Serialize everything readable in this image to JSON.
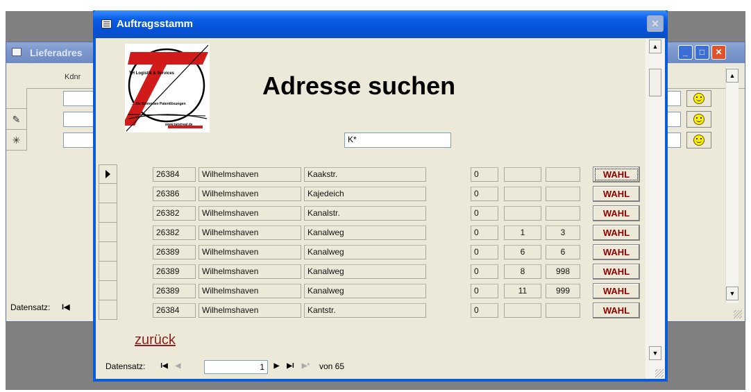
{
  "background_window": {
    "title": "Lieferadres",
    "column_header": "Kdnr",
    "nav_label": "Datensatz:",
    "record_symbols": [
      "",
      "✎",
      "✳"
    ],
    "controls": {
      "minimize": "_",
      "maximize": "□",
      "close": "✕"
    }
  },
  "main_window": {
    "title": "Auftragsstamm",
    "close": "✕",
    "logo": {
      "line1": "TH Logistik & Services",
      "line2": "... die führenden Patentlösungen",
      "url": "www.tatstreal.de"
    },
    "heading": "Adresse suchen",
    "search": {
      "value": "K*"
    },
    "select_button_label": "WAHL",
    "rows": [
      {
        "plz": "26384",
        "city": "Wilhelmshaven",
        "street": "Kaakstr.",
        "a": "0",
        "from": "",
        "to": ""
      },
      {
        "plz": "26386",
        "city": "Wilhelmshaven",
        "street": "Kajedeich",
        "a": "0",
        "from": "",
        "to": ""
      },
      {
        "plz": "26382",
        "city": "Wilhelmshaven",
        "street": "Kanalstr.",
        "a": "0",
        "from": "",
        "to": ""
      },
      {
        "plz": "26382",
        "city": "Wilhelmshaven",
        "street": "Kanalweg",
        "a": "0",
        "from": "1",
        "to": "3"
      },
      {
        "plz": "26389",
        "city": "Wilhelmshaven",
        "street": "Kanalweg",
        "a": "0",
        "from": "6",
        "to": "6"
      },
      {
        "plz": "26389",
        "city": "Wilhelmshaven",
        "street": "Kanalweg",
        "a": "0",
        "from": "8",
        "to": "998"
      },
      {
        "plz": "26389",
        "city": "Wilhelmshaven",
        "street": "Kanalweg",
        "a": "0",
        "from": "11",
        "to": "999"
      },
      {
        "plz": "26384",
        "city": "Wilhelmshaven",
        "street": "Kantstr.",
        "a": "0",
        "from": "",
        "to": ""
      }
    ],
    "back_link": "zurück",
    "navigation": {
      "label": "Datensatz:",
      "current_record": "1",
      "of_text": "von 65",
      "first": "I◀",
      "prev": "◀",
      "next": "▶",
      "last": "▶I",
      "new": "▶*"
    },
    "scroll": {
      "up": "▲",
      "down": "▼"
    }
  },
  "colors": {
    "titlebar": "#0550d8",
    "window_bg": "#ece9d8",
    "wahl_text": "#8b0000",
    "back_link": "#8b2020",
    "logo_red": "#d11a1a"
  }
}
